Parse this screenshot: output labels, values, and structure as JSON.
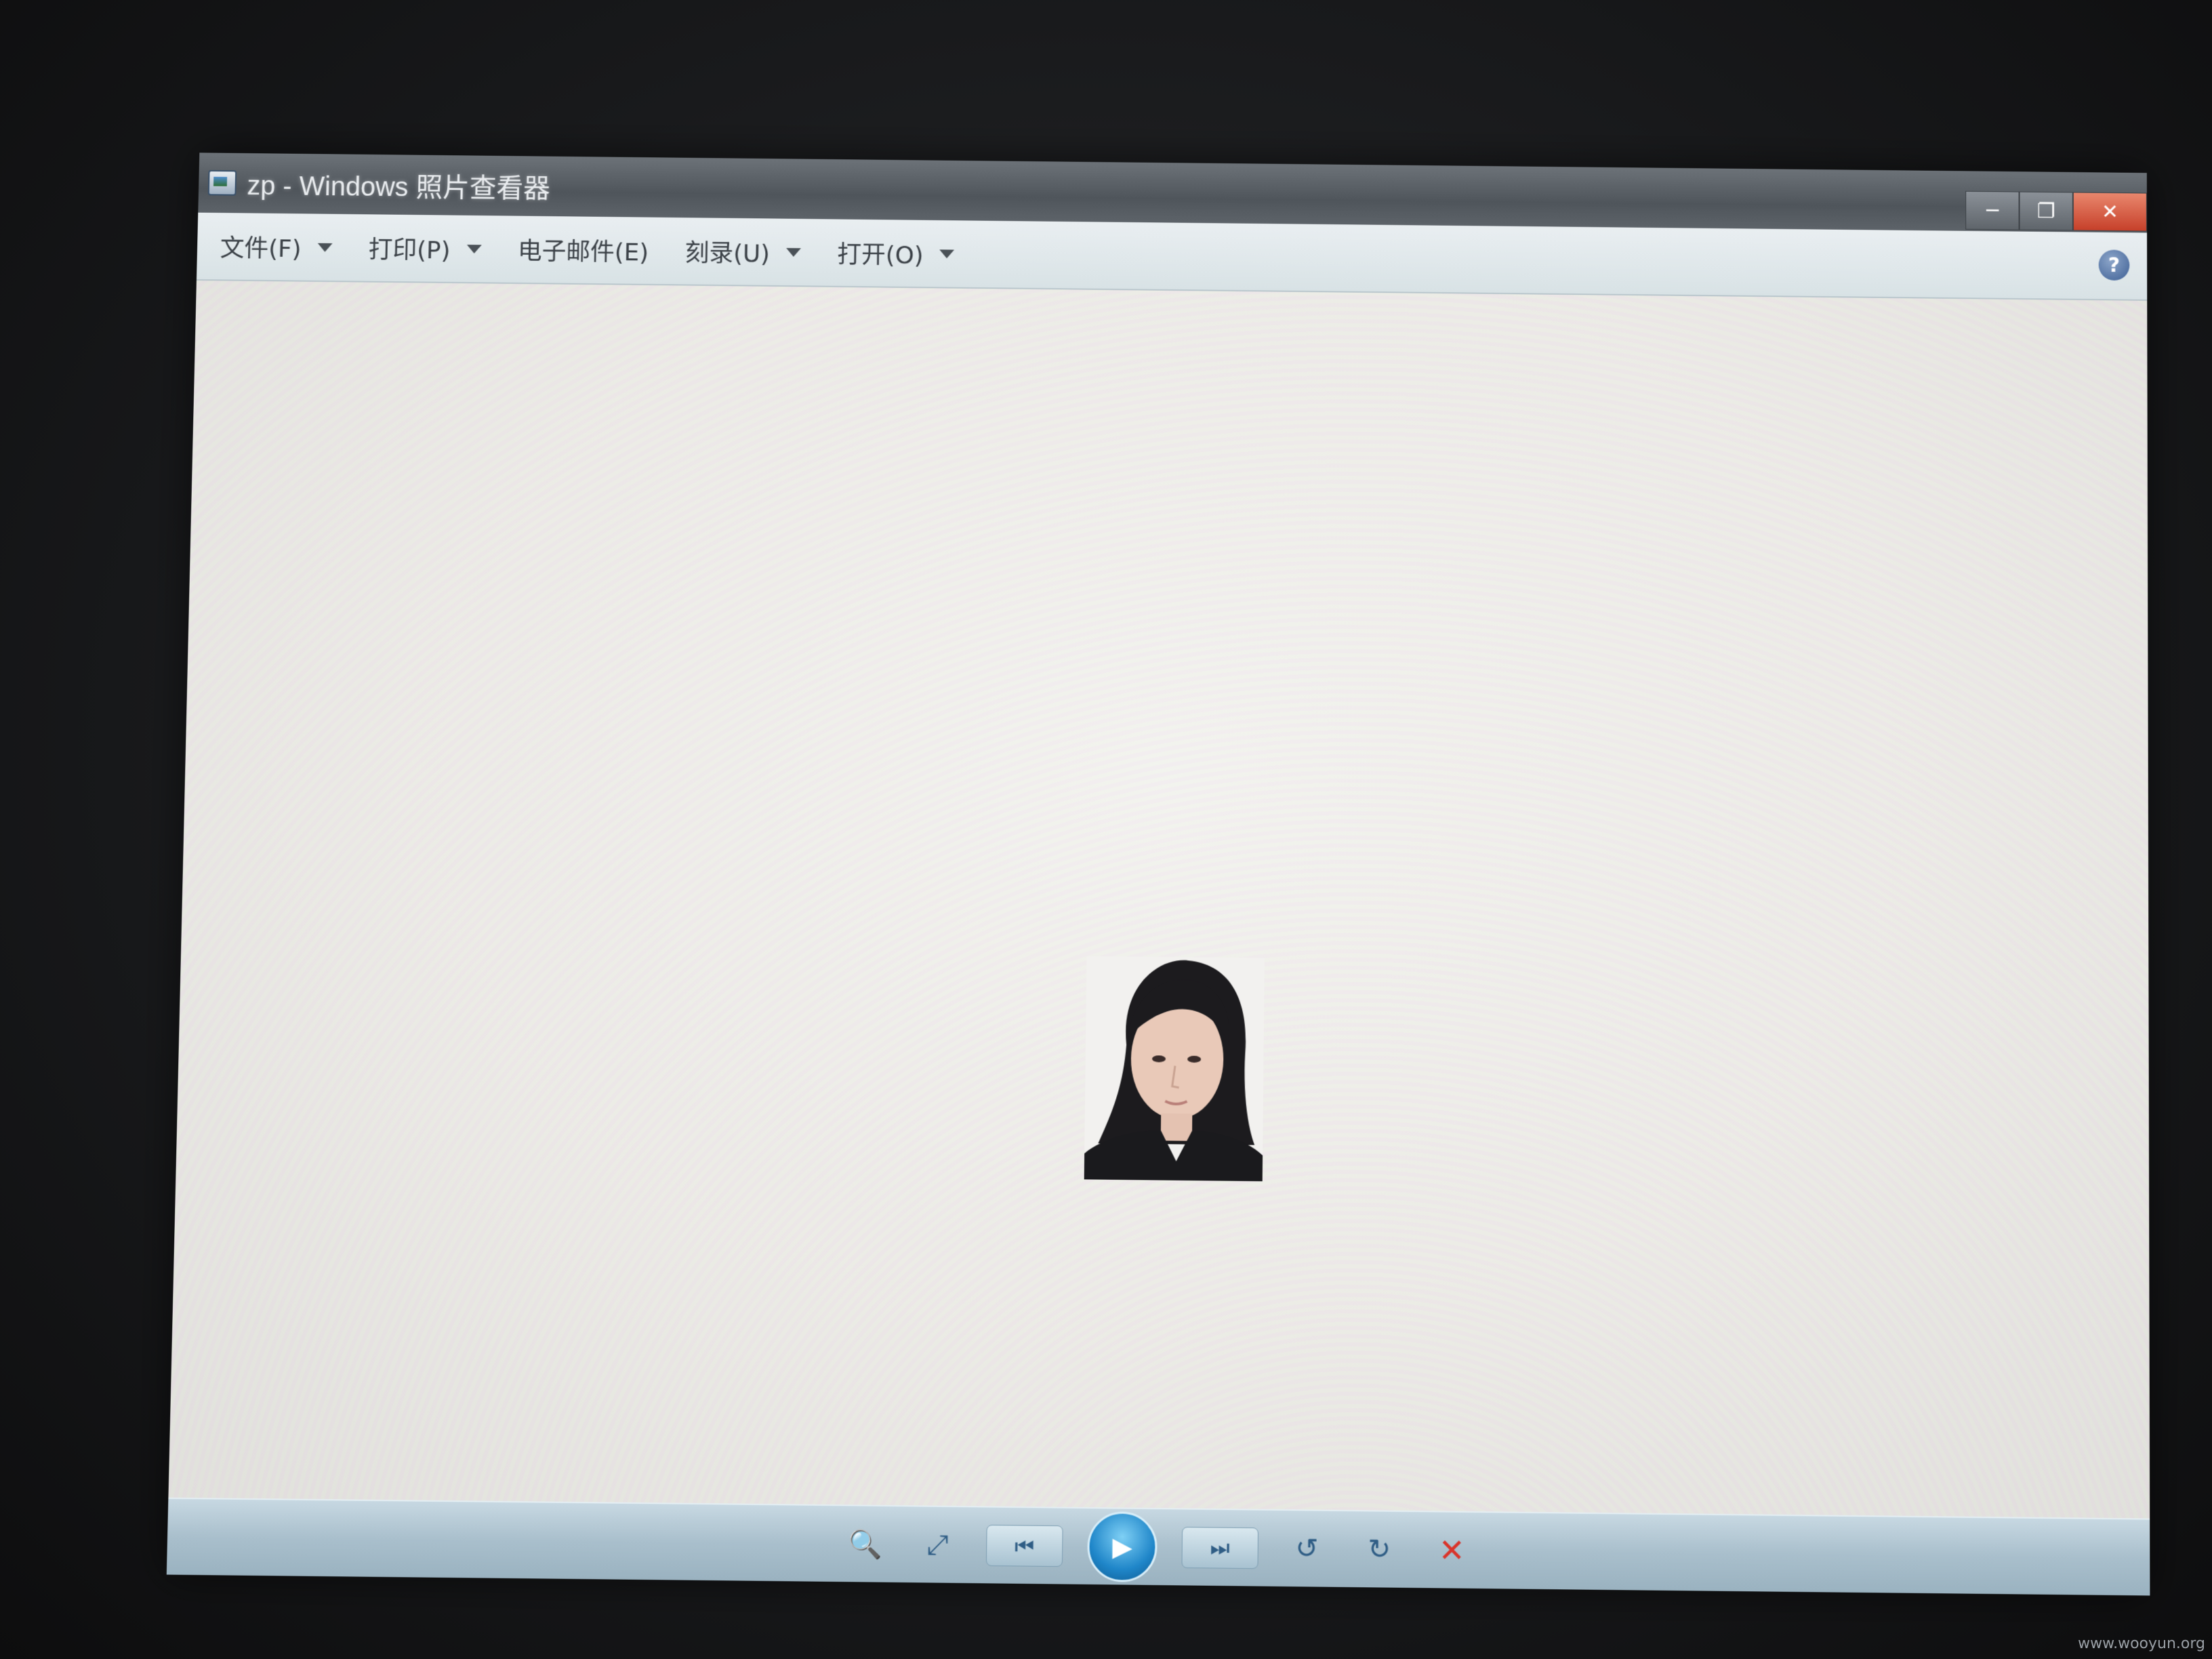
{
  "window": {
    "title": "zp - Windows 照片查看器",
    "minimize_label": "─",
    "maximize_label": "❐",
    "close_label": "✕"
  },
  "menu": {
    "items": [
      {
        "label": "文件(F)",
        "has_dropdown": true
      },
      {
        "label": "打印(P)",
        "has_dropdown": true
      },
      {
        "label": "电子邮件(E)",
        "has_dropdown": false
      },
      {
        "label": "刻录(U)",
        "has_dropdown": true
      },
      {
        "label": "打开(O)",
        "has_dropdown": true
      }
    ],
    "help_label": "?"
  },
  "viewer": {
    "photo_description": "portrait-photo"
  },
  "controls": {
    "zoom_icon": "🔍",
    "fit_icon": "⤢",
    "prev_icon": "⏮",
    "play_icon": "▶",
    "next_icon": "⏭",
    "rotate_ccw_icon": "↺",
    "rotate_cw_icon": "↻",
    "delete_icon": "✕"
  },
  "watermark": "www.wooyun.org"
}
